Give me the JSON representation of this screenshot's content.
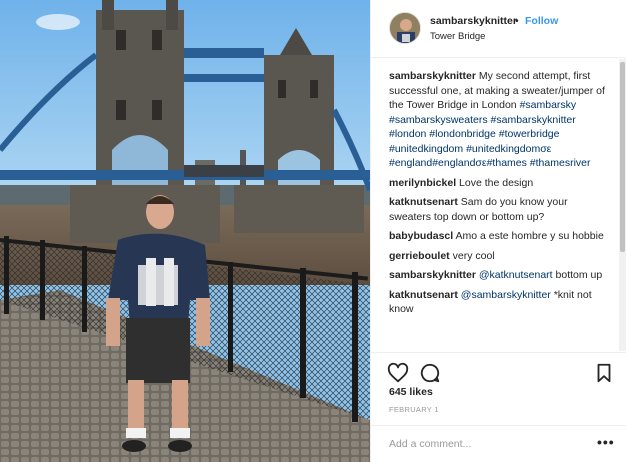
{
  "photo": {
    "alt_subject": "Man in front of Tower Bridge"
  },
  "header": {
    "username": "sambarskyknitter",
    "separator": "•",
    "follow_label": "Follow",
    "location": "Tower Bridge"
  },
  "caption": {
    "username": "sambarskyknitter",
    "text": "My second attempt, first successful one, at making a sweater/jumper of the Tower Bridge in London",
    "hashtags": [
      "#sambarsky",
      "#sambarskysweaters",
      "#sambarskyknitter",
      "#london",
      "#londonbridge",
      "#towerbridge",
      "#unitedkingdom",
      "#unitedkingdomσε",
      "#england",
      "#englandσε",
      "#thames",
      "#thamesriver"
    ]
  },
  "comments": [
    {
      "username": "merilynbickel",
      "text": "Love the design"
    },
    {
      "username": "katknutsenart",
      "text": "Sam do you know your sweaters top down or bottom up?"
    },
    {
      "username": "babybudascl",
      "text": "Amo a este hombre y su hobbie"
    },
    {
      "username": "gerrieboulet",
      "text": "very cool"
    },
    {
      "username": "sambarskyknitter",
      "mention": "@katknutsenart",
      "text": "bottom up"
    },
    {
      "username": "katknutsenart",
      "mention": "@sambarskyknitter",
      "text": "*knit not know"
    }
  ],
  "actions": {
    "like_icon": "heart-icon",
    "comment_icon": "speech-bubble-icon",
    "save_icon": "bookmark-icon",
    "likes_label": "645 likes",
    "date": "FEBRUARY 1"
  },
  "add_comment": {
    "placeholder": "Add a comment...",
    "more_icon": "more-options-icon"
  },
  "colors": {
    "link_blue": "#3897f0",
    "hashtag": "#003569",
    "text": "#262626",
    "muted": "#999999",
    "border": "#efefef"
  }
}
